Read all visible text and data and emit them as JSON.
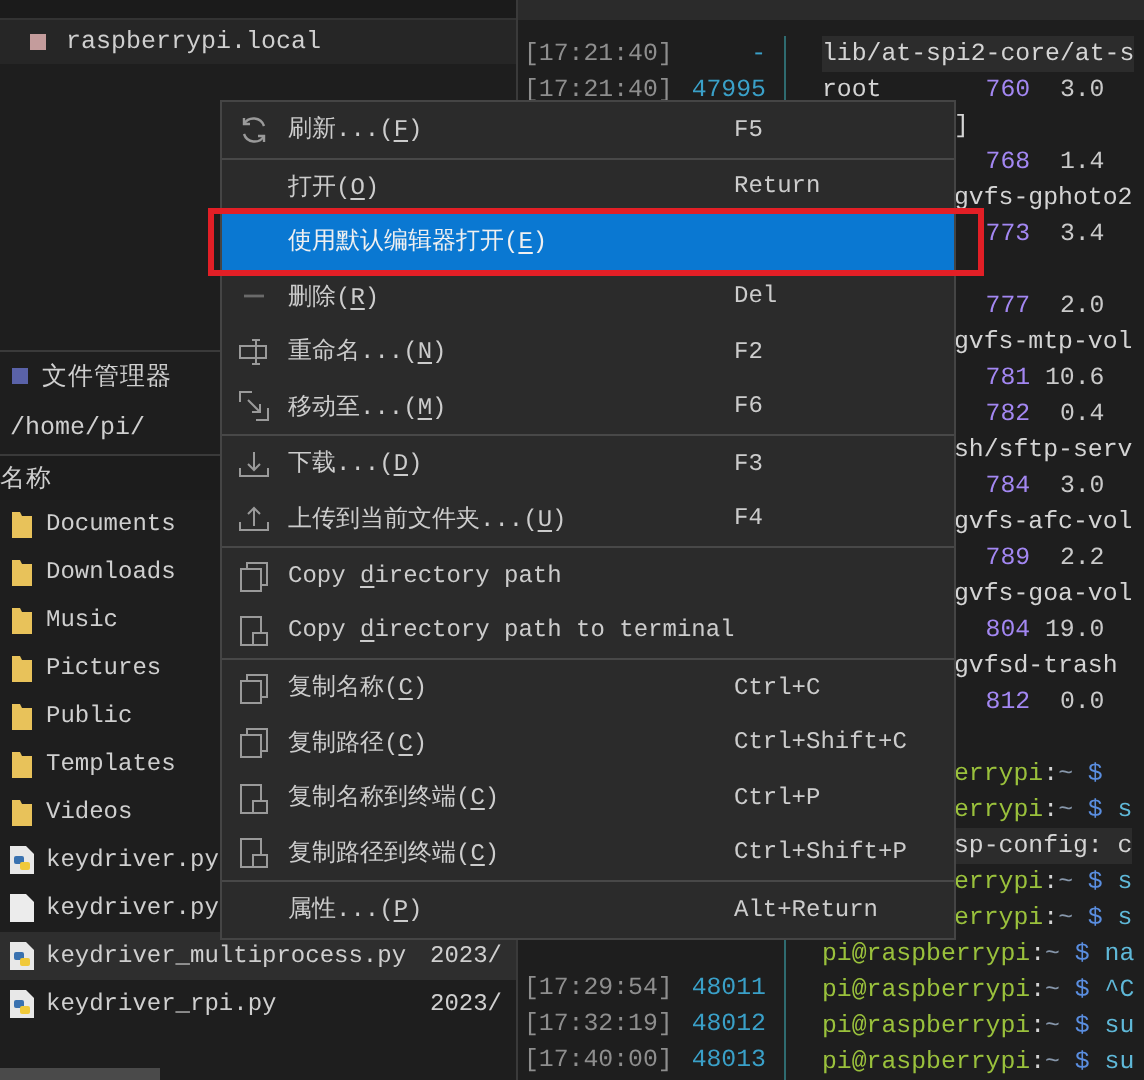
{
  "files": {
    "host": "raspberrypi.local",
    "section_title": "文件管理器",
    "path": "/home/pi/",
    "column": "名称",
    "rows": [
      {
        "name": "Documents",
        "kind": "folder",
        "selected": false
      },
      {
        "name": "Downloads",
        "kind": "folder",
        "selected": false
      },
      {
        "name": "Music",
        "kind": "folder",
        "selected": false
      },
      {
        "name": "Pictures",
        "kind": "folder",
        "selected": false
      },
      {
        "name": "Public",
        "kind": "folder",
        "selected": false
      },
      {
        "name": "Templates",
        "kind": "folder",
        "selected": false
      },
      {
        "name": "Videos",
        "kind": "folder",
        "selected": false
      },
      {
        "name": "keydriver.py",
        "kind": "python",
        "selected": false
      },
      {
        "name": "keydriver.py",
        "kind": "file",
        "selected": false
      },
      {
        "name": "keydriver_multiprocess.py",
        "kind": "python",
        "selected": true,
        "date": "2023/"
      },
      {
        "name": "keydriver_rpi.py",
        "kind": "python",
        "selected": false,
        "date": "2023/"
      }
    ]
  },
  "history": {
    "top": [
      {
        "time": "[17:21:40]",
        "id": "-"
      },
      {
        "time": "[17:21:40]",
        "id": "47995"
      }
    ],
    "bottom": [
      {
        "time": "[17:29:54]",
        "id": "48011"
      },
      {
        "time": "[17:32:19]",
        "id": "48012"
      },
      {
        "time": "[17:40:00]",
        "id": "48013"
      }
    ]
  },
  "terminal": [
    {
      "kind": "text",
      "text": "lib/at-spi2-core/at-s",
      "highlighted": true
    },
    {
      "kind": "stats",
      "user": "root",
      "pid": "760",
      "cpu": "3.0"
    },
    {
      "kind": "tail",
      "text": "]"
    },
    {
      "kind": "stats",
      "pid": "768",
      "cpu": "1.4"
    },
    {
      "kind": "tail",
      "text": "gvfs-gphoto2"
    },
    {
      "kind": "stats",
      "pid": "773",
      "cpu": "3.4"
    },
    {
      "kind": "gap"
    },
    {
      "kind": "stats",
      "pid": "777",
      "cpu": "2.0"
    },
    {
      "kind": "tail",
      "text": "gvfs-mtp-vol"
    },
    {
      "kind": "stats",
      "pid": "781",
      "cpu": "10.6"
    },
    {
      "kind": "stats",
      "pid": "782",
      "cpu": "0.4"
    },
    {
      "kind": "tail",
      "text": "sh/sftp-serv"
    },
    {
      "kind": "stats",
      "pid": "784",
      "cpu": "3.0"
    },
    {
      "kind": "tail",
      "text": "gvfs-afc-vol"
    },
    {
      "kind": "stats",
      "pid": "789",
      "cpu": "2.2"
    },
    {
      "kind": "tail",
      "text": "gvfs-goa-vol"
    },
    {
      "kind": "stats",
      "pid": "804",
      "cpu": "19.0"
    },
    {
      "kind": "tail",
      "text": "gvfsd-trash"
    },
    {
      "kind": "stats",
      "pid": "812",
      "cpu": "0.0"
    },
    {
      "kind": "gap"
    },
    {
      "kind": "prompt_tail",
      "host": "errypi",
      "sep": ":",
      "cwd": "~",
      "sign": "$"
    },
    {
      "kind": "prompt_tail",
      "host": "errypi",
      "sep": ":",
      "cwd": "~",
      "sign": "$",
      "command": "s"
    },
    {
      "kind": "tail",
      "text": "sp-config: c",
      "highlighted": true
    },
    {
      "kind": "prompt_tail",
      "host": "errypi",
      "sep": ":",
      "cwd": "~",
      "sign": "$",
      "command": "s"
    },
    {
      "kind": "prompt_tail",
      "host": "errypi",
      "sep": ":",
      "cwd": "~",
      "sign": "$",
      "command": "s"
    },
    {
      "kind": "prompt",
      "host": "pi@raspberrypi",
      "sep": ":",
      "cwd": "~",
      "sign": "$",
      "command": "na"
    },
    {
      "kind": "prompt",
      "host": "pi@raspberrypi",
      "sep": ":",
      "cwd": "~",
      "sign": "$",
      "command": "^C"
    },
    {
      "kind": "prompt",
      "host": "pi@raspberrypi",
      "sep": ":",
      "cwd": "~",
      "sign": "$",
      "command": "su"
    },
    {
      "kind": "prompt",
      "host": "pi@raspberrypi",
      "sep": ":",
      "cwd": "~",
      "sign": "$",
      "command": "su"
    }
  ],
  "menu": {
    "groups": [
      [
        {
          "before": "刷新...(",
          "mnemonic": "F",
          "after": ")",
          "shortcut": "F5",
          "selected": false
        }
      ],
      [
        {
          "before": "打开(",
          "mnemonic": "O",
          "after": ")",
          "shortcut": "Return",
          "selected": false
        },
        {
          "before": "使用默认编辑器打开(",
          "mnemonic": "E",
          "after": ")",
          "selected": true,
          "annotated": true
        },
        {
          "before": "删除(",
          "mnemonic": "R",
          "after": ")",
          "shortcut": "Del",
          "selected": false
        },
        {
          "before": "重命名...(",
          "mnemonic": "N",
          "after": ")",
          "shortcut": "F2",
          "selected": false
        },
        {
          "before": "移动至...(",
          "mnemonic": "M",
          "after": ")",
          "shortcut": "F6",
          "selected": false
        }
      ],
      [
        {
          "before": "下载...(",
          "mnemonic": "D",
          "after": ")",
          "shortcut": "F3",
          "selected": false
        },
        {
          "before": "上传到当前文件夹...(",
          "mnemonic": "U",
          "after": ")",
          "shortcut": "F4",
          "selected": false
        }
      ],
      [
        {
          "before": "Copy ",
          "mnemonic": "d",
          "after": "irectory path",
          "selected": false
        },
        {
          "before": "Copy ",
          "mnemonic": "d",
          "after": "irectory path to terminal",
          "selected": false
        }
      ],
      [
        {
          "before": "复制名称(",
          "mnemonic": "C",
          "after": ")",
          "shortcut": "Ctrl+C",
          "selected": false
        },
        {
          "before": "复制路径(",
          "mnemonic": "C",
          "after": ")",
          "shortcut": "Ctrl+Shift+C",
          "selected": false
        },
        {
          "before": "复制名称到终端(",
          "mnemonic": "C",
          "after": ")",
          "shortcut": "Ctrl+P",
          "selected": false
        },
        {
          "before": "复制路径到终端(",
          "mnemonic": "C",
          "after": ")",
          "shortcut": "Ctrl+Shift+P",
          "selected": false
        }
      ],
      [
        {
          "before": "属性...(",
          "mnemonic": "P",
          "after": ")",
          "shortcut": "Alt+Return",
          "selected": false
        }
      ]
    ]
  }
}
